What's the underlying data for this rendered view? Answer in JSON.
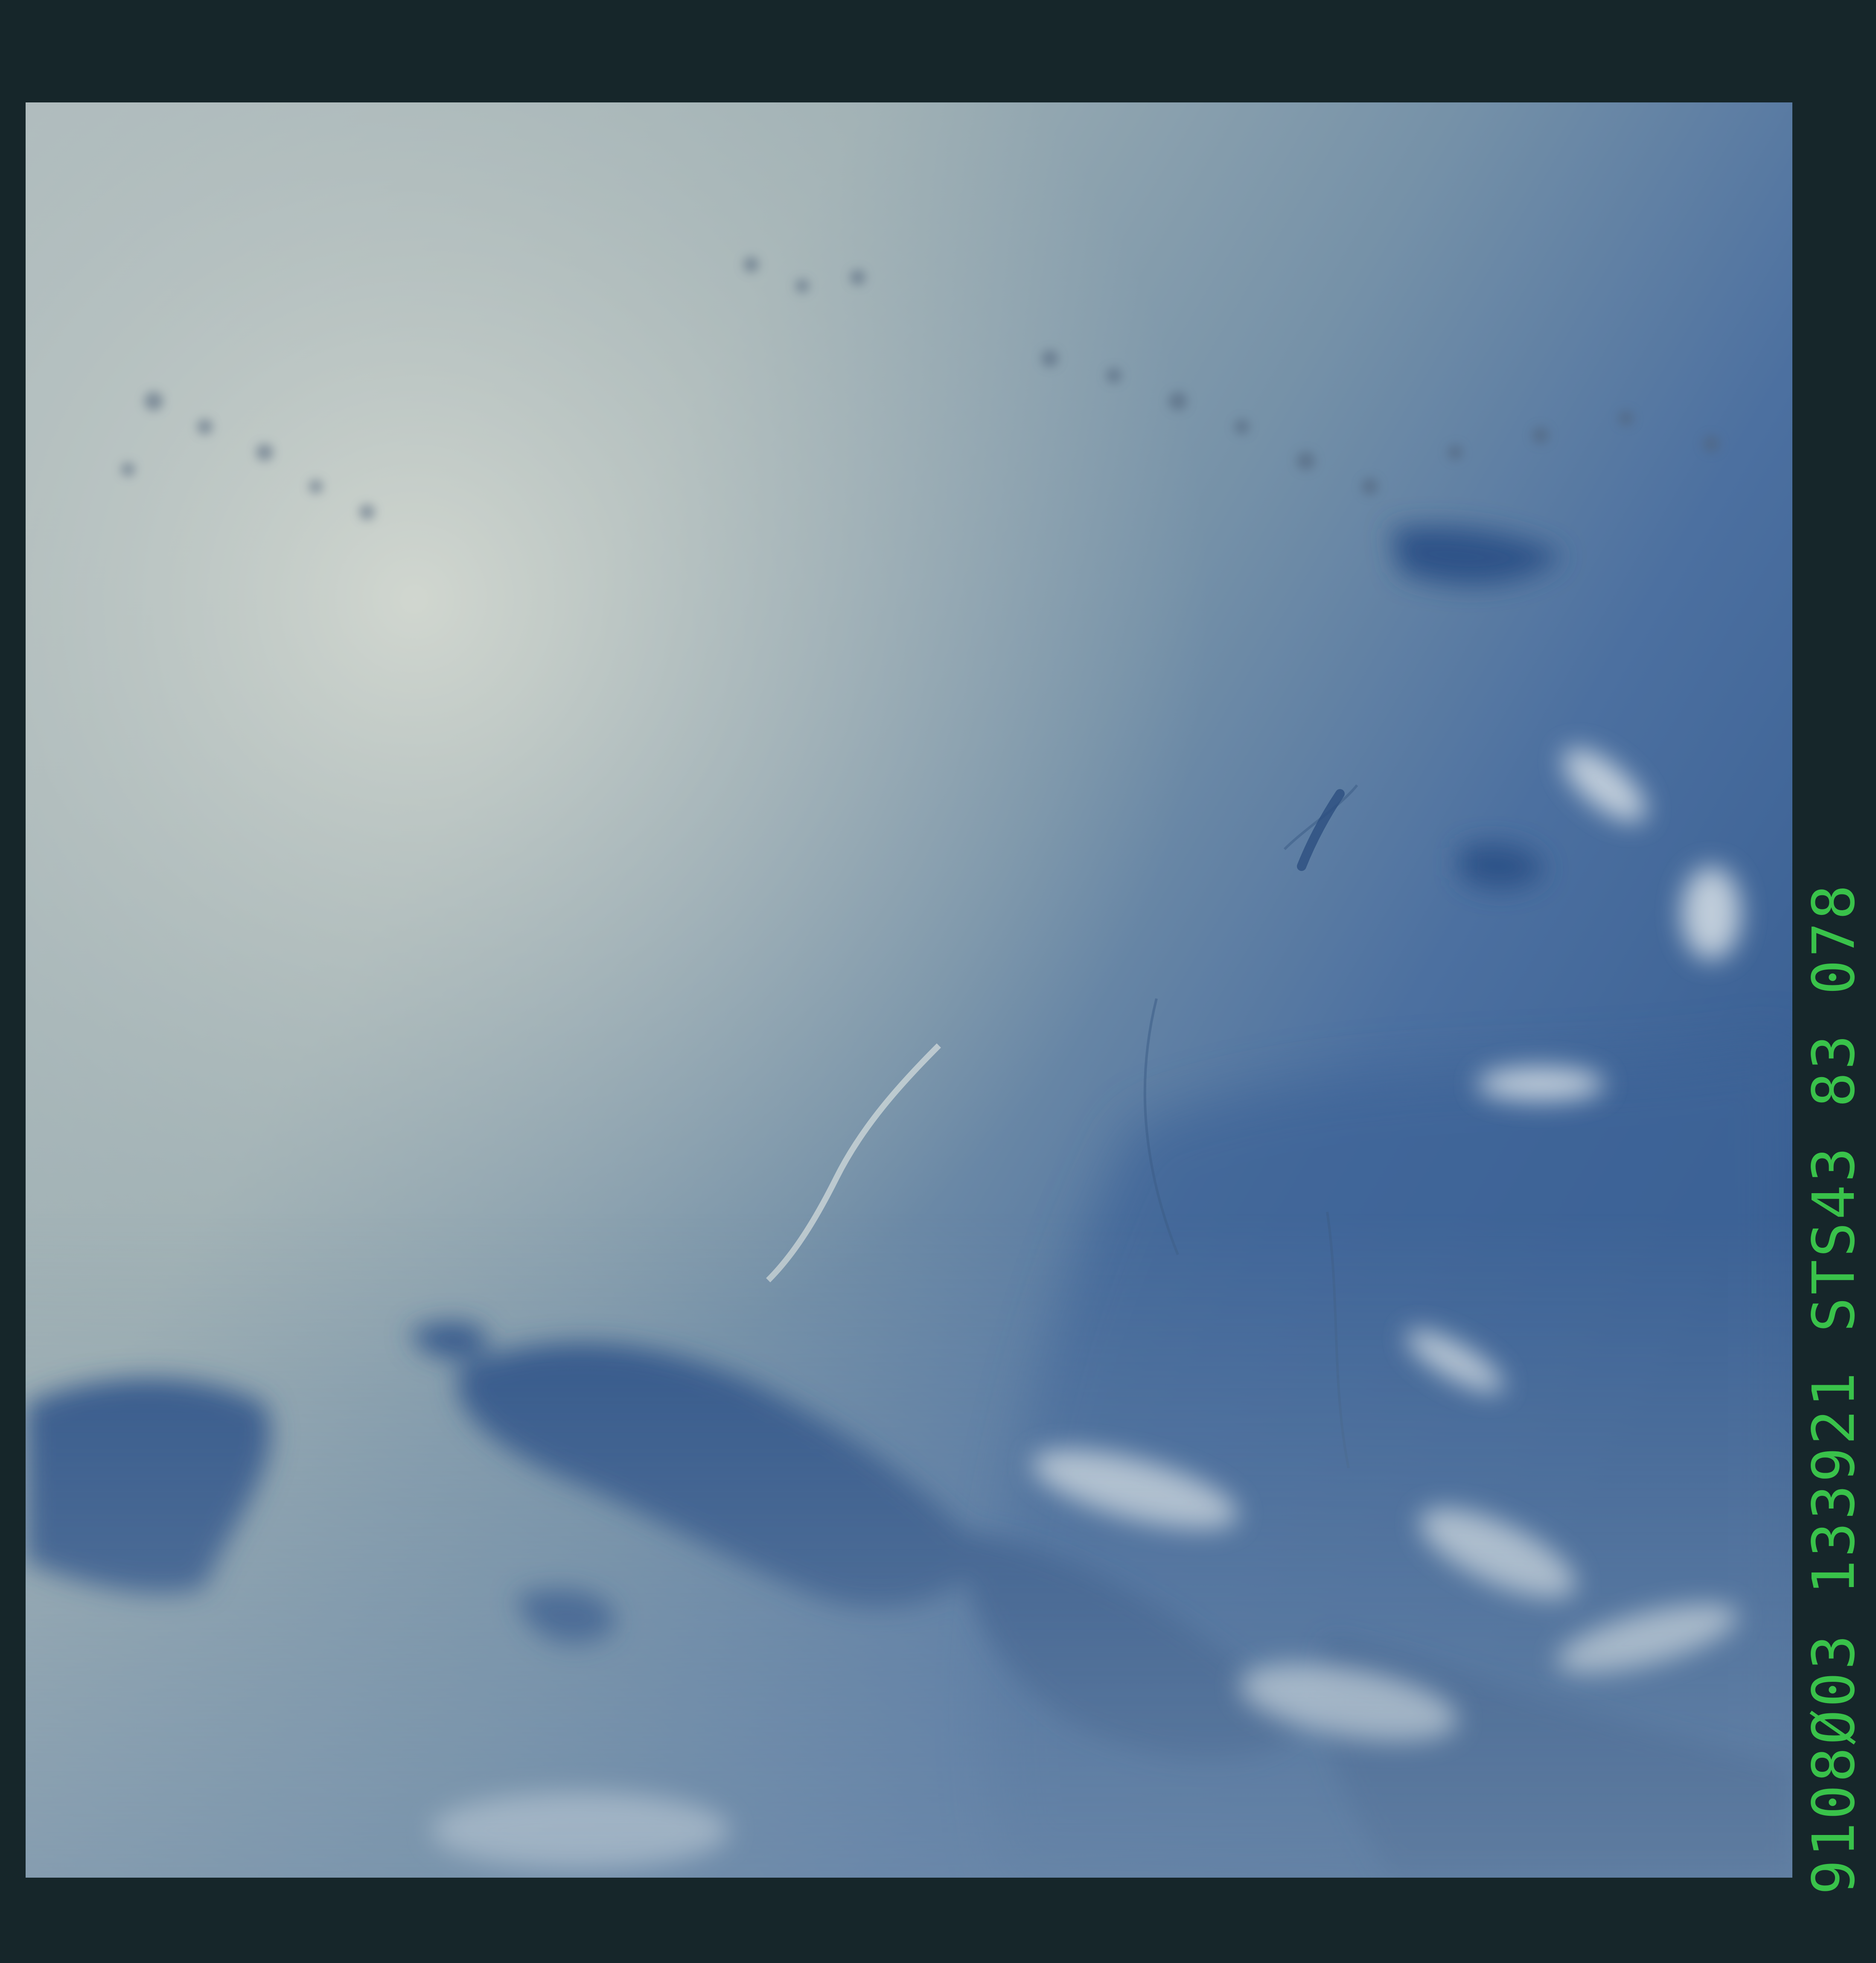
{
  "film_code": "9108Ø03 133921 STS43 83 078",
  "scene": {
    "description_icon": "earth-orbital-photo"
  },
  "colors": {
    "border": "#16262a",
    "code_text": "#39c24a",
    "haze": "#a9b7b8",
    "ocean": "#3a5f91",
    "deep_ocean": "#2c4f85",
    "cloud": "#dfe6ea"
  }
}
